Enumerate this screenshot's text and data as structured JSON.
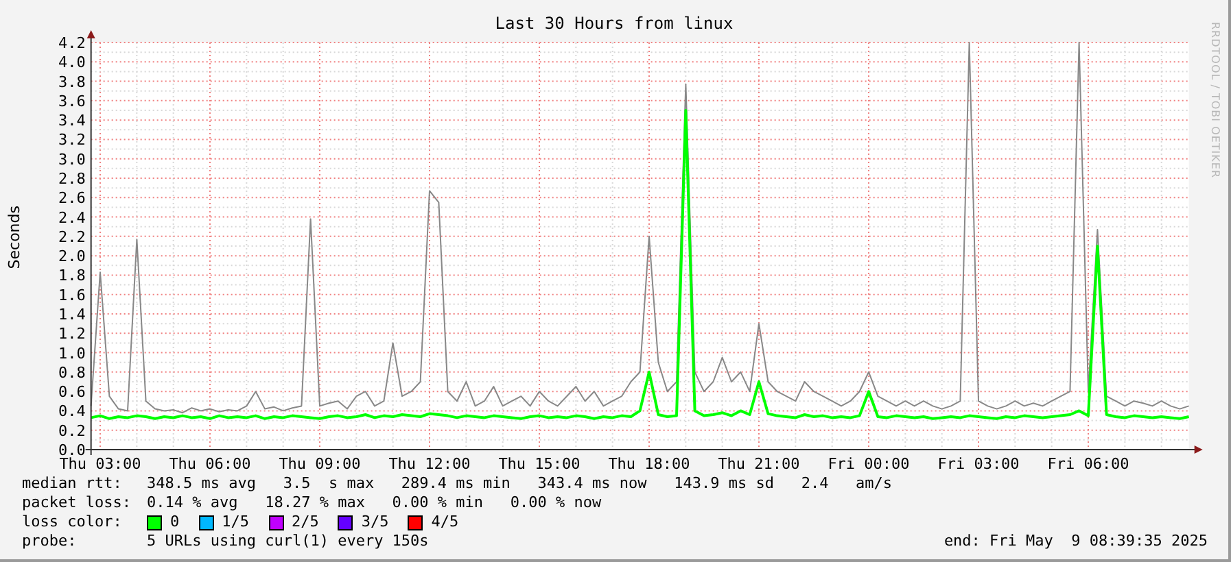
{
  "credit": "RRDTOOL / TOBI OETIKER",
  "chart": {
    "chart_data": {
      "type": "line",
      "title": "Last 30 Hours from linux",
      "ylabel": "Seconds",
      "grid": true,
      "ylim": [
        0,
        4.2
      ],
      "categories": [
        null,
        "Thu 03:00",
        null,
        null,
        null,
        null,
        null,
        null,
        null,
        null,
        null,
        null,
        null,
        "Thu 06:00",
        null,
        null,
        null,
        null,
        null,
        null,
        null,
        null,
        null,
        null,
        null,
        "Thu 09:00",
        null,
        null,
        null,
        null,
        null,
        null,
        null,
        null,
        null,
        null,
        null,
        "Thu 12:00",
        null,
        null,
        null,
        null,
        null,
        null,
        null,
        null,
        null,
        null,
        null,
        "Thu 15:00",
        null,
        null,
        null,
        null,
        null,
        null,
        null,
        null,
        null,
        null,
        null,
        "Thu 18:00",
        null,
        null,
        null,
        null,
        null,
        null,
        null,
        null,
        null,
        null,
        null,
        "Thu 21:00",
        null,
        null,
        null,
        null,
        null,
        null,
        null,
        null,
        null,
        null,
        null,
        "Fri 00:00",
        null,
        null,
        null,
        null,
        null,
        null,
        null,
        null,
        null,
        null,
        null,
        "Fri 03:00",
        null,
        null,
        null,
        null,
        null,
        null,
        null,
        null,
        null,
        null,
        null,
        "Fri 06:00",
        null,
        null,
        null,
        null,
        null,
        null,
        null,
        null,
        null,
        null,
        null
      ],
      "yticks": [
        {
          "value": 0,
          "label": "0.0"
        },
        {
          "value": 0.2,
          "label": "0.2"
        },
        {
          "value": 0.4,
          "label": "0.4"
        },
        {
          "value": 0.6,
          "label": "0.6"
        },
        {
          "value": 0.8,
          "label": "0.8"
        },
        {
          "value": 1.0,
          "label": "1.0"
        },
        {
          "value": 1.2,
          "label": "1.2"
        },
        {
          "value": 1.4,
          "label": "1.4"
        },
        {
          "value": 1.6,
          "label": "1.6"
        },
        {
          "value": 1.8,
          "label": "1.8"
        },
        {
          "value": 2.0,
          "label": "2.0"
        },
        {
          "value": 2.2,
          "label": "2.2"
        },
        {
          "value": 2.4,
          "label": "2.4"
        },
        {
          "value": 2.6,
          "label": "2.6"
        },
        {
          "value": 2.8,
          "label": "2.8"
        },
        {
          "value": 3.0,
          "label": "3.0"
        },
        {
          "value": 3.2,
          "label": "3.2"
        },
        {
          "value": 3.4,
          "label": "3.4"
        },
        {
          "value": 3.6,
          "label": "3.6"
        },
        {
          "value": 3.8,
          "label": "3.8"
        },
        {
          "value": 4.0,
          "label": "4.0"
        },
        {
          "value": 4.2,
          "label": "4.2"
        }
      ],
      "series": [
        {
          "color": "#888888",
          "values": [
            0.45,
            1.83,
            0.55,
            0.42,
            0.4,
            2.17,
            0.5,
            0.42,
            0.4,
            0.41,
            0.38,
            0.43,
            0.4,
            0.42,
            0.39,
            0.41,
            0.4,
            0.45,
            0.6,
            0.42,
            0.44,
            0.4,
            0.43,
            0.45,
            2.38,
            0.45,
            0.48,
            0.5,
            0.42,
            0.55,
            0.6,
            0.45,
            0.5,
            1.1,
            0.55,
            0.6,
            0.7,
            2.67,
            2.55,
            0.6,
            0.5,
            0.7,
            0.45,
            0.5,
            0.65,
            0.45,
            0.5,
            0.55,
            0.45,
            0.6,
            0.5,
            0.45,
            0.55,
            0.65,
            0.5,
            0.6,
            0.45,
            0.5,
            0.55,
            0.7,
            0.8,
            2.2,
            0.9,
            0.6,
            0.7,
            3.77,
            0.8,
            0.6,
            0.7,
            0.95,
            0.7,
            0.8,
            0.6,
            1.3,
            0.7,
            0.6,
            0.55,
            0.5,
            0.7,
            0.6,
            0.55,
            0.5,
            0.45,
            0.5,
            0.6,
            0.8,
            0.55,
            0.5,
            0.45,
            0.5,
            0.45,
            0.5,
            0.45,
            0.42,
            0.45,
            0.5,
            4.2,
            0.5,
            0.45,
            0.42,
            0.45,
            0.5,
            0.45,
            0.48,
            0.45,
            0.5,
            0.55,
            0.6,
            4.2,
            0.6,
            2.27,
            0.55,
            0.5,
            0.45,
            0.5,
            0.48,
            0.45,
            0.5,
            0.45,
            0.42,
            0.45
          ]
        },
        {
          "color": "#00ff00",
          "values": [
            0.33,
            0.35,
            0.32,
            0.34,
            0.33,
            0.35,
            0.34,
            0.32,
            0.34,
            0.33,
            0.35,
            0.33,
            0.34,
            0.32,
            0.35,
            0.33,
            0.34,
            0.33,
            0.35,
            0.32,
            0.34,
            0.33,
            0.35,
            0.34,
            0.33,
            0.32,
            0.34,
            0.35,
            0.33,
            0.34,
            0.36,
            0.33,
            0.35,
            0.34,
            0.36,
            0.35,
            0.34,
            0.37,
            0.36,
            0.35,
            0.33,
            0.35,
            0.34,
            0.33,
            0.35,
            0.34,
            0.33,
            0.32,
            0.34,
            0.35,
            0.33,
            0.34,
            0.33,
            0.35,
            0.34,
            0.32,
            0.34,
            0.33,
            0.35,
            0.34,
            0.4,
            0.8,
            0.36,
            0.34,
            0.35,
            3.5,
            0.4,
            0.35,
            0.36,
            0.38,
            0.35,
            0.4,
            0.36,
            0.7,
            0.37,
            0.35,
            0.34,
            0.33,
            0.36,
            0.34,
            0.35,
            0.33,
            0.34,
            0.33,
            0.35,
            0.6,
            0.34,
            0.33,
            0.35,
            0.34,
            0.33,
            0.34,
            0.32,
            0.33,
            0.34,
            0.33,
            0.35,
            0.34,
            0.33,
            0.32,
            0.34,
            0.33,
            0.35,
            0.34,
            0.33,
            0.34,
            0.35,
            0.36,
            0.4,
            0.35,
            2.1,
            0.36,
            0.34,
            0.33,
            0.35,
            0.34,
            0.33,
            0.34,
            0.33,
            0.32,
            0.34
          ]
        }
      ]
    }
  },
  "legend": {
    "stats": [
      {
        "label": "median rtt:",
        "text": "348.5 ms avg   3.5  s max   289.4 ms min   343.4 ms now   143.9 ms sd   2.4   am/s"
      },
      {
        "label": "packet loss:",
        "text": "0.14 % avg   18.27 % max   0.00 % min   0.00 % now"
      }
    ],
    "loss_colors": {
      "label": "loss color:",
      "items": [
        {
          "label": "0",
          "color": "#00ff00"
        },
        {
          "label": "1/5",
          "color": "#00b8ff"
        },
        {
          "label": "2/5",
          "color": "#c000ff"
        },
        {
          "label": "3/5",
          "color": "#6400ff"
        },
        {
          "label": "4/5",
          "color": "#ff0000"
        }
      ]
    },
    "probe": {
      "label": "probe:",
      "text": "5 URLs using curl(1) every 150s"
    },
    "end": "end: Fri May  9 08:39:35 2025"
  }
}
